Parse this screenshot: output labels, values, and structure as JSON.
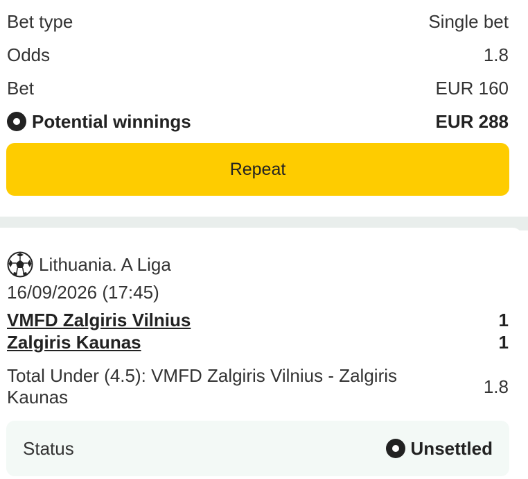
{
  "summary": {
    "bet_type_label": "Bet type",
    "bet_type_value": "Single bet",
    "odds_label": "Odds",
    "odds_value": "1.8",
    "bet_label": "Bet",
    "bet_value": "EUR 160",
    "potential_label": "Potential winnings",
    "potential_value": "EUR 288",
    "repeat_label": "Repeat"
  },
  "event": {
    "league": "Lithuania. A Liga",
    "league_icon": "soccer-ball-icon",
    "datetime": "16/09/2026 (17:45)",
    "teams": [
      {
        "name": "VMFD Zalgiris Vilnius",
        "score": "1"
      },
      {
        "name": "Zalgiris Kaunas",
        "score": "1"
      }
    ],
    "market": "Total Under (4.5): VMFD Zalgiris Vilnius - Zalgiris Kaunas",
    "market_odds": "1.8",
    "status_label": "Status",
    "status_value": "Unsettled"
  },
  "colors": {
    "accent": "#fecc00",
    "separator": "#e9eeec",
    "status_bg": "#f3f9f6"
  }
}
